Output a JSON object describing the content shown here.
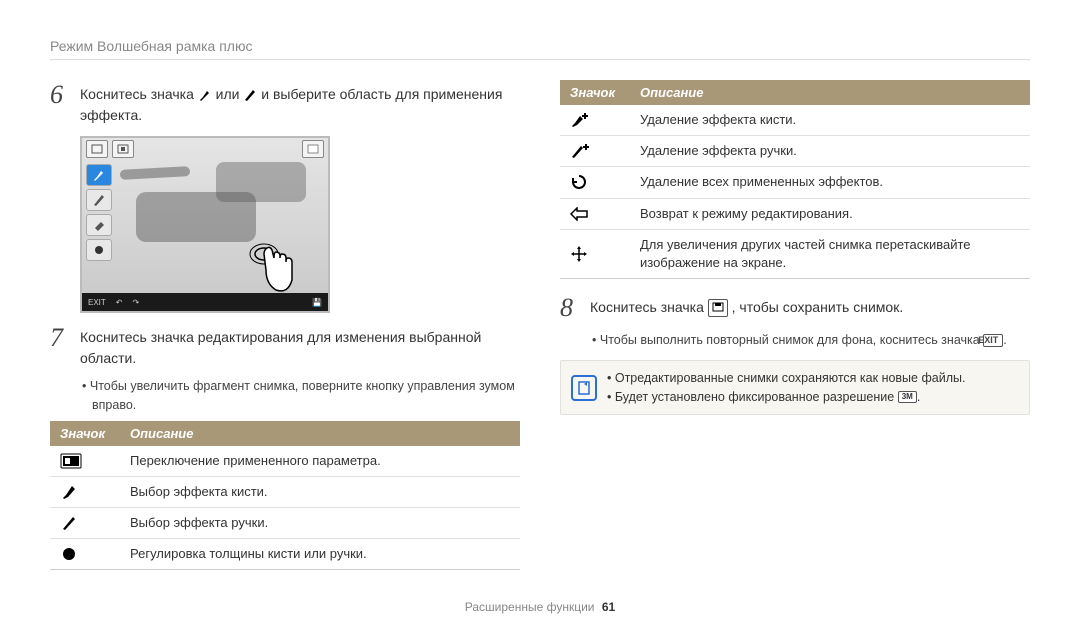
{
  "header": {
    "title": "Режим Волшебная рамка плюс"
  },
  "left": {
    "step6": {
      "num": "6",
      "text_pre": "Коснитесь значка ",
      "text_mid": " или ",
      "text_post": " и выберите область для применения эффекта."
    },
    "device_bottom": {
      "exit": "EXIT"
    },
    "step7": {
      "num": "7",
      "text": "Коснитесь значка редактирования для изменения выбранной области.",
      "bullet": "Чтобы увеличить фрагмент снимка, поверните кнопку управления зумом вправо."
    },
    "table": {
      "head_icon": "Значок",
      "head_desc": "Описание",
      "rows": [
        {
          "desc": "Переключение примененного параметра."
        },
        {
          "desc": "Выбор эффекта кисти."
        },
        {
          "desc": "Выбор эффекта ручки."
        },
        {
          "desc": "Регулировка толщины кисти или ручки."
        }
      ]
    }
  },
  "right": {
    "table": {
      "head_icon": "Значок",
      "head_desc": "Описание",
      "rows": [
        {
          "desc": "Удаление эффекта кисти."
        },
        {
          "desc": "Удаление эффекта ручки."
        },
        {
          "desc": "Удаление всех примененных эффектов."
        },
        {
          "desc": "Возврат к режиму редактирования."
        },
        {
          "desc": "Для увеличения других частей снимка перетаскивайте изображение на экране."
        }
      ]
    },
    "step8": {
      "num": "8",
      "text_pre": "Коснитесь значка ",
      "text_post": ", чтобы сохранить снимок.",
      "bullet_pre": "Чтобы выполнить повторный снимок для фона, коснитесь значка ",
      "bullet_exit": "EXIT",
      "bullet_post": "."
    },
    "note": {
      "items": [
        "Отредактированные снимки сохраняются как новые файлы.",
        "Будет установлено фиксированное разрешение"
      ],
      "res_badge": "3M",
      "period": "."
    }
  },
  "footer": {
    "section": "Расширенные функции",
    "page": "61"
  }
}
